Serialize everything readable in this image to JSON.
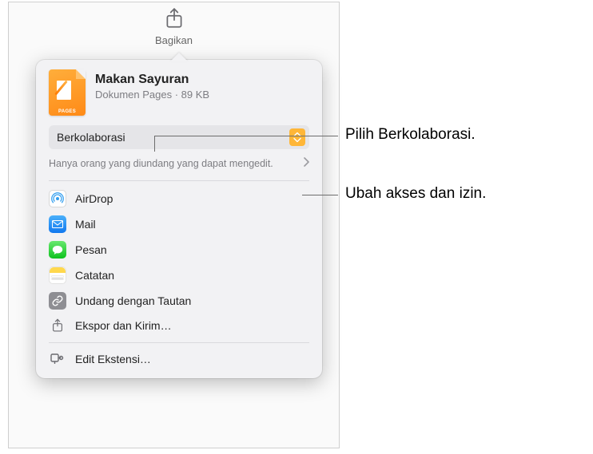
{
  "toolbar": {
    "share_label": "Bagikan"
  },
  "document": {
    "title": "Makan Sayuran",
    "subtitle": "Dokumen Pages · 89 KB",
    "icon_tag": "PAGES"
  },
  "mode_select": {
    "label": "Berkolaborasi"
  },
  "permissions": {
    "text": "Hanya orang yang diundang yang dapat mengedit."
  },
  "share_options": [
    {
      "name": "airdrop",
      "label": "AirDrop"
    },
    {
      "name": "mail",
      "label": "Mail"
    },
    {
      "name": "messages",
      "label": "Pesan"
    },
    {
      "name": "notes",
      "label": "Catatan"
    },
    {
      "name": "link",
      "label": "Undang dengan Tautan"
    },
    {
      "name": "export",
      "label": "Ekspor dan Kirim…"
    }
  ],
  "edit_extensions": "Edit Ekstensi…",
  "callouts": {
    "c1": "Pilih Berkolaborasi.",
    "c2": "Ubah akses dan izin."
  }
}
